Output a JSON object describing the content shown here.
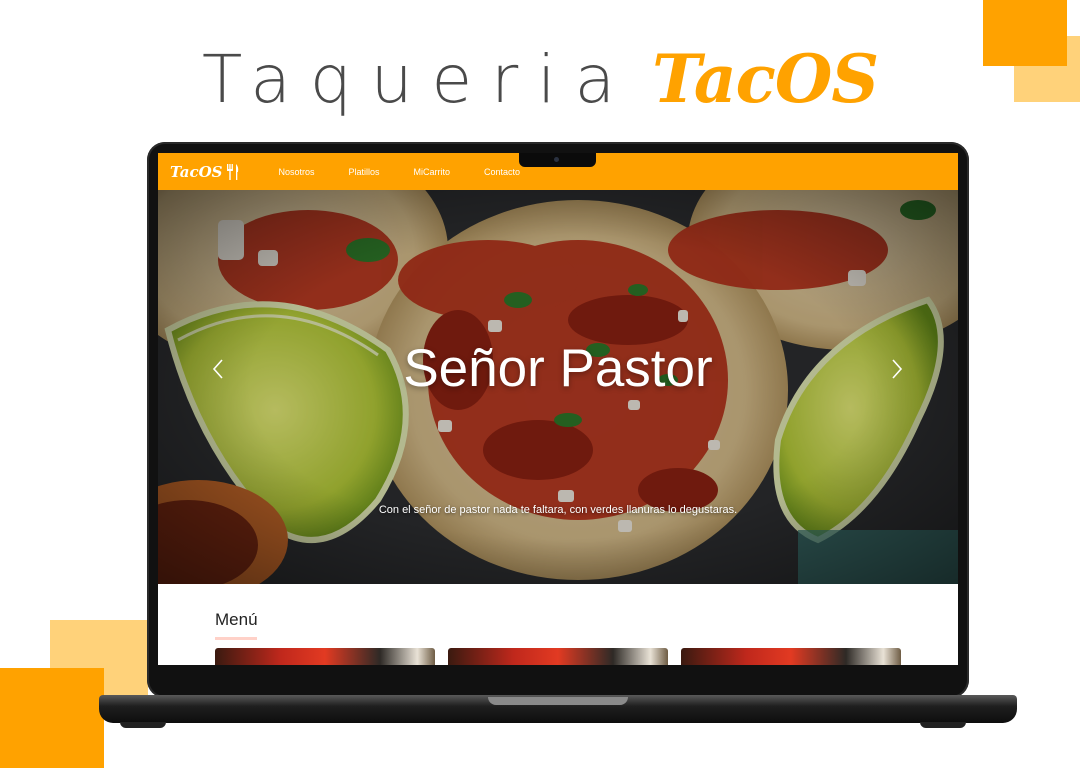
{
  "headline": {
    "word": "Taqueria",
    "brand": "TacOS"
  },
  "navbar": {
    "logo": "TacOS",
    "links": [
      "Nosotros",
      "Platillos",
      "MiCarrito",
      "Contacto"
    ]
  },
  "hero": {
    "title": "Señor Pastor",
    "caption": "Con el señor de pastor nada te faltara, con verdes llanuras lo degustaras."
  },
  "menu": {
    "title": "Menú"
  },
  "colors": {
    "accent": "#ffa200",
    "accent_light": "#ffd27a",
    "underline": "#ffd1c8"
  },
  "icons": [
    "fork-knife-icon",
    "chevron-left-icon",
    "chevron-right-icon"
  ]
}
